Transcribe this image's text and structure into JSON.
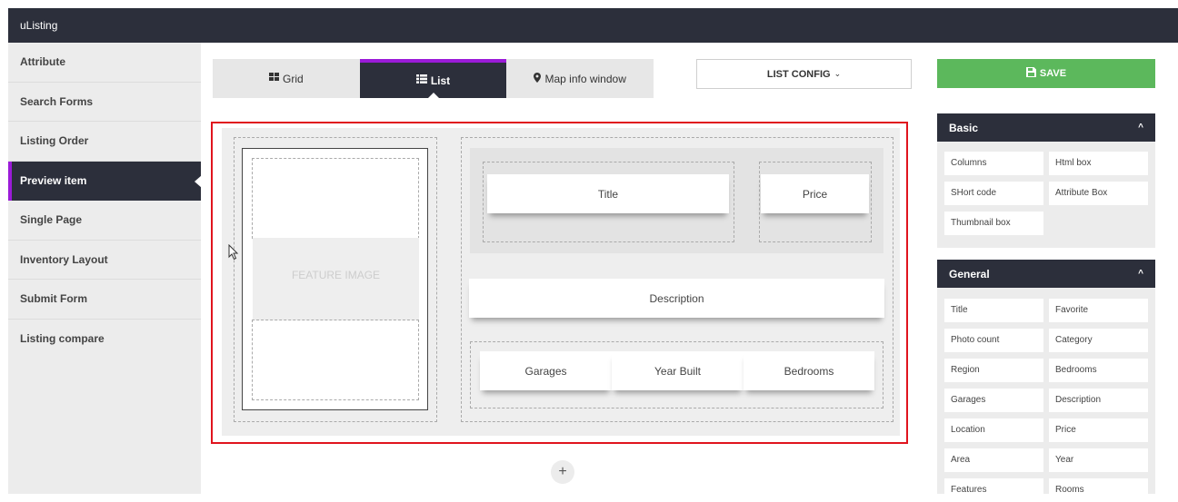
{
  "app": {
    "title": "uListing"
  },
  "sidebar": {
    "items": [
      {
        "label": "Attribute"
      },
      {
        "label": "Search Forms"
      },
      {
        "label": "Listing Order"
      },
      {
        "label": "Preview item"
      },
      {
        "label": "Single Page"
      },
      {
        "label": "Inventory Layout"
      },
      {
        "label": "Submit Form"
      },
      {
        "label": "Listing compare"
      }
    ],
    "active_index": 3
  },
  "tabs": [
    {
      "label": "Grid",
      "icon": "grid-icon"
    },
    {
      "label": "List",
      "icon": "list-icon"
    },
    {
      "label": "Map info window",
      "icon": "map-marker-icon"
    }
  ],
  "toolbar": {
    "list_config_label": "LIST CONFIG",
    "chevron": "⌄",
    "save_label": "SAVE"
  },
  "canvas": {
    "feature_image_label": "FEATURE IMAGE",
    "title_label": "Title",
    "price_label": "Price",
    "description_label": "Description",
    "garages_label": "Garages",
    "year_built_label": "Year Built",
    "bedrooms_label": "Bedrooms",
    "add_symbol": "+"
  },
  "panels": {
    "basic": {
      "title": "Basic",
      "items": [
        "Columns",
        "Html box",
        "SHort code",
        "Attribute Box",
        "Thumbnail box"
      ]
    },
    "general": {
      "title": "General",
      "items": [
        "Title",
        "Favorite",
        "Photo count",
        "Category",
        "Region",
        "Bedrooms",
        "Garages",
        "Description",
        "Location",
        "Price",
        "Area",
        "Year",
        "Features",
        "Rooms"
      ]
    },
    "caret": "^"
  },
  "colors": {
    "dark": "#2c2f3b",
    "accent": "#9b1bd8",
    "save": "#5cb85c",
    "highlight": "#e0141e"
  }
}
